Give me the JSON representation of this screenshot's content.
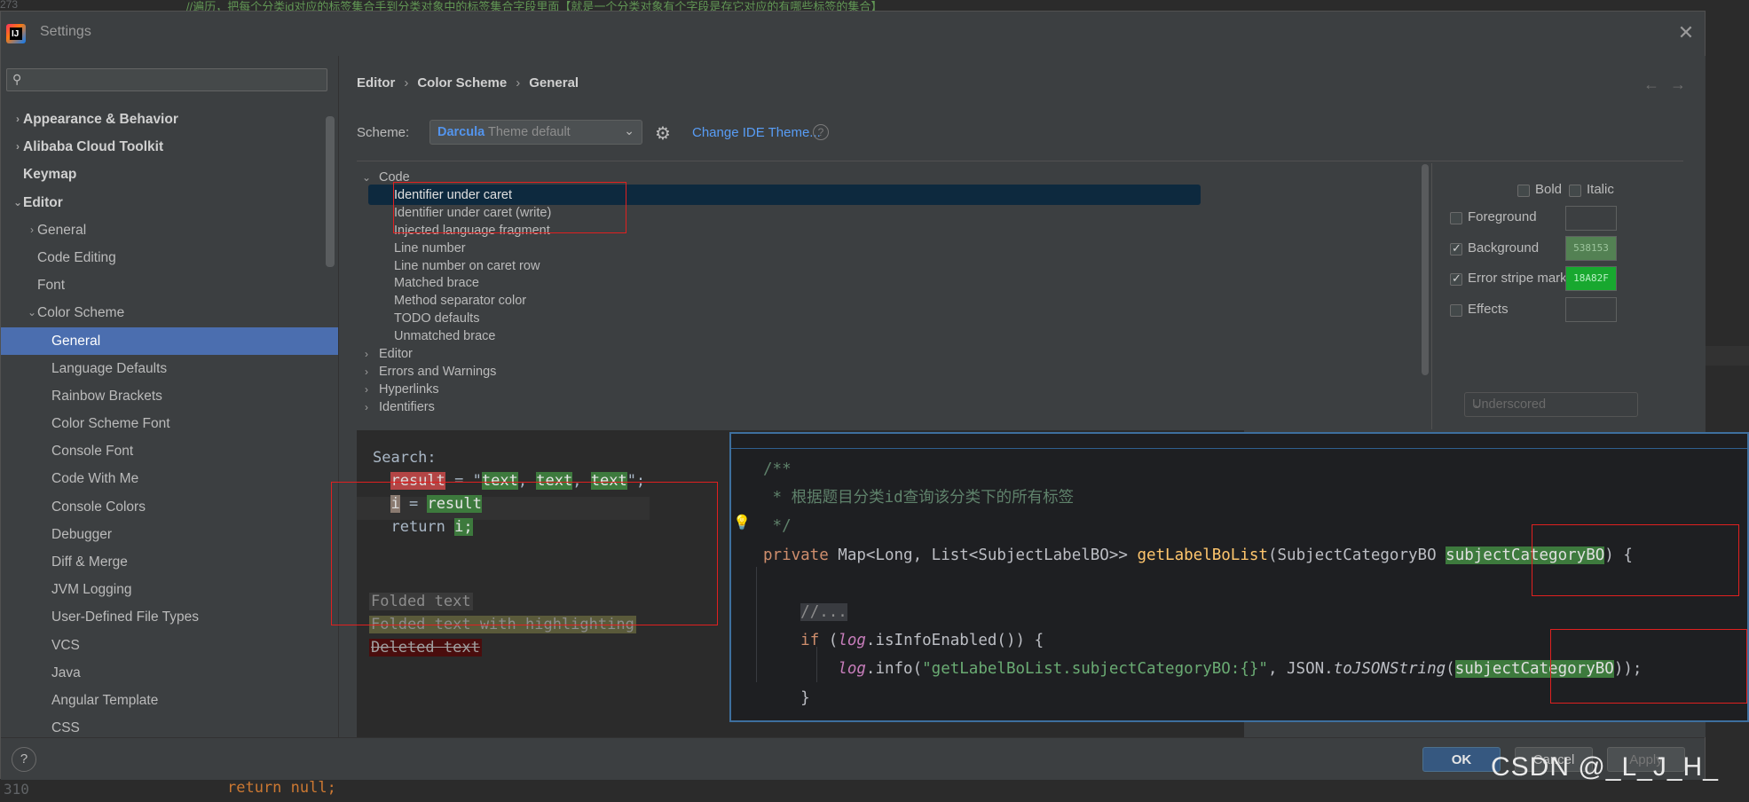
{
  "background": {
    "top_gutter": "273",
    "top_comment": "//遍历，把每个分类id对应的标签集合手到分类对象中的标签集合字段里面【就是一个分类对象有个字段是存它对应的有哪些标签的集合】",
    "bottom_gutter": "310",
    "bottom_code": "return null;"
  },
  "dialog": {
    "title": "Settings",
    "logo_letters": "IJ"
  },
  "sidebar": {
    "search_placeholder": "",
    "items": [
      {
        "label": "Appearance & Behavior",
        "level": 0,
        "arrow": "›",
        "bold": true
      },
      {
        "label": "Alibaba Cloud Toolkit",
        "level": 0,
        "arrow": "›",
        "bold": true
      },
      {
        "label": "Keymap",
        "level": 0,
        "arrow": "",
        "bold": true
      },
      {
        "label": "Editor",
        "level": 0,
        "arrow": "⌄",
        "bold": true
      },
      {
        "label": "General",
        "level": 1,
        "arrow": "›",
        "bold": false
      },
      {
        "label": "Code Editing",
        "level": 1,
        "arrow": "",
        "bold": false
      },
      {
        "label": "Font",
        "level": 1,
        "arrow": "",
        "bold": false
      },
      {
        "label": "Color Scheme",
        "level": 1,
        "arrow": "⌄",
        "bold": false
      },
      {
        "label": "General",
        "level": 2,
        "arrow": "",
        "bold": false,
        "selected": true
      },
      {
        "label": "Language Defaults",
        "level": 2,
        "arrow": "",
        "bold": false
      },
      {
        "label": "Rainbow Brackets",
        "level": 2,
        "arrow": "",
        "bold": false
      },
      {
        "label": "Color Scheme Font",
        "level": 2,
        "arrow": "",
        "bold": false
      },
      {
        "label": "Console Font",
        "level": 2,
        "arrow": "",
        "bold": false
      },
      {
        "label": "Code With Me",
        "level": 2,
        "arrow": "",
        "bold": false
      },
      {
        "label": "Console Colors",
        "level": 2,
        "arrow": "",
        "bold": false
      },
      {
        "label": "Debugger",
        "level": 2,
        "arrow": "",
        "bold": false
      },
      {
        "label": "Diff & Merge",
        "level": 2,
        "arrow": "",
        "bold": false
      },
      {
        "label": "JVM Logging",
        "level": 2,
        "arrow": "",
        "bold": false
      },
      {
        "label": "User-Defined File Types",
        "level": 2,
        "arrow": "",
        "bold": false
      },
      {
        "label": "VCS",
        "level": 2,
        "arrow": "",
        "bold": false
      },
      {
        "label": "Java",
        "level": 2,
        "arrow": "",
        "bold": false
      },
      {
        "label": "Angular Template",
        "level": 2,
        "arrow": "",
        "bold": false
      },
      {
        "label": "CSS",
        "level": 2,
        "arrow": "",
        "bold": false
      }
    ]
  },
  "breadcrumb": {
    "part1": "Editor",
    "part2": "Color Scheme",
    "part3": "General",
    "sep": "›"
  },
  "scheme": {
    "label": "Scheme:",
    "name": "Darcula",
    "sub": "Theme default",
    "change_theme": "Change IDE Theme...",
    "help": "?"
  },
  "options": {
    "items": [
      {
        "label": "Code",
        "level": 0,
        "arrow": "⌄"
      },
      {
        "label": "Identifier under caret",
        "level": 1,
        "selected": true
      },
      {
        "label": "Identifier under caret (write)",
        "level": 1
      },
      {
        "label": "Injected language fragment",
        "level": 1
      },
      {
        "label": "Line number",
        "level": 1
      },
      {
        "label": "Line number on caret row",
        "level": 1
      },
      {
        "label": "Matched brace",
        "level": 1
      },
      {
        "label": "Method separator color",
        "level": 1
      },
      {
        "label": "TODO defaults",
        "level": 1
      },
      {
        "label": "Unmatched brace",
        "level": 1
      },
      {
        "label": "Editor",
        "level": 0,
        "arrow": "›"
      },
      {
        "label": "Errors and Warnings",
        "level": 0,
        "arrow": "›"
      },
      {
        "label": "Hyperlinks",
        "level": 0,
        "arrow": "›"
      },
      {
        "label": "Identifiers",
        "level": 0,
        "arrow": "›"
      }
    ]
  },
  "attributes": {
    "bold": "Bold",
    "italic": "Italic",
    "foreground": "Foreground",
    "background": "Background",
    "background_value": "538153",
    "background_color": "#538153",
    "error_stripe": "Error stripe mark",
    "error_stripe_value": "18A82F",
    "error_stripe_color": "#18A82F",
    "effects": "Effects",
    "effects_type": "Underscored"
  },
  "preview": {
    "search_label": "Search:",
    "l1_var": "result",
    "l1_eq": " = \"",
    "l1_t1": "text",
    "l1_sep1": ", ",
    "l1_t2": "text",
    "l1_sep2": ", ",
    "l1_t3": "text",
    "l1_end": "\";",
    "l2_var": "i",
    "l2_eq": " = ",
    "l2_val": "result",
    "l3_kw": "return ",
    "l3_val": "i;",
    "folded1": "Folded text",
    "folded2": "Folded text with highlighting",
    "deleted": "Deleted text"
  },
  "code": {
    "l1": "/**",
    "l2": " * 根据题目分类id查询该分类下的所有标签",
    "l3": " */",
    "l4_kw": "private ",
    "l4_type": "Map<Long, List<SubjectLabelBO>> ",
    "l4_fn": "getLabelBoList",
    "l4_paren": "(SubjectCategoryBO ",
    "l4_param": "subjectCategoryBO",
    "l4_end": ") {",
    "l6_fold": "//...",
    "l7_kw": "if ",
    "l7_a": "(",
    "l7_log": "log",
    "l7_b": ".isInfoEnabled()) {",
    "l8_log": "log",
    "l8_a": ".info(",
    "l8_str": "\"getLabelBoList.subjectCategoryBO:{}\"",
    "l8_b": ", JSON.",
    "l8_static": "toJSONString",
    "l8_c": "(",
    "l8_param": "subjectCategoryBO",
    "l8_d": "));",
    "l9": "}"
  },
  "buttons": {
    "ok": "OK",
    "cancel": "Cancel",
    "apply": "Apply",
    "help": "?"
  },
  "watermark": "CSDN @_L_J_H_"
}
